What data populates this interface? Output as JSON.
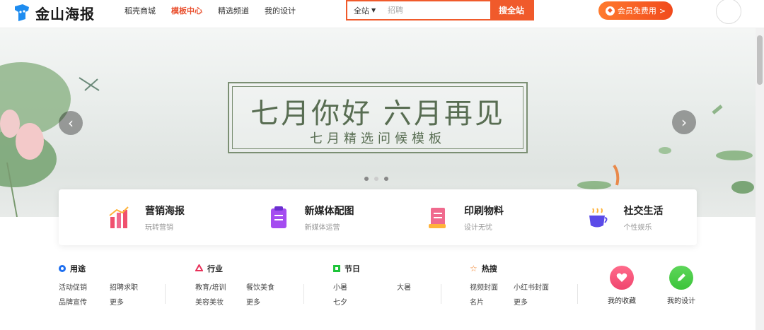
{
  "header": {
    "logo_text": "金山海报",
    "nav": [
      "稻壳商城",
      "模板中心",
      "精选频道",
      "我的设计"
    ],
    "active_nav": "模板中心",
    "search": {
      "scope": "全站",
      "placeholder": "招聘",
      "button": "搜全站"
    },
    "vip_button": "会员免费用",
    "vip_arrow": ">"
  },
  "banner": {
    "title": "七月你好 六月再见",
    "subtitle": "七月精选问候模板",
    "prev": "‹",
    "next": "›",
    "slides": 3,
    "active_slide": 2
  },
  "categories": [
    {
      "title": "营销海报",
      "sub": "玩转营销",
      "icon": "bar-chart-icon",
      "color": "#f0506e"
    },
    {
      "title": "新媒体配图",
      "sub": "新媒体运营",
      "icon": "clipboard-icon",
      "color": "#a44cf0"
    },
    {
      "title": "印刷物料",
      "sub": "设计无忧",
      "icon": "document-icon",
      "color": "#f06a8e"
    },
    {
      "title": "社交生活",
      "sub": "个性娱乐",
      "icon": "coffee-cup-icon",
      "color": "#5b4be8"
    }
  ],
  "tag_sections": [
    {
      "head": "用途",
      "icon": "circle-icon",
      "color": "#1e6ff0",
      "items": [
        "活动促销",
        "招聘求职",
        "品牌宣传",
        "更多"
      ]
    },
    {
      "head": "行业",
      "icon": "triangle-icon",
      "color": "#e8325a",
      "items": [
        "教育/培训",
        "餐饮美食",
        "美容美妆",
        "更多"
      ]
    },
    {
      "head": "节日",
      "icon": "square-icon",
      "color": "#1ec43a",
      "items": [
        "小暑",
        "大暑",
        "七夕"
      ]
    },
    {
      "head": "热搜",
      "icon": "star-icon",
      "color": "#f07a1e",
      "items": [
        "视频封面",
        "小红书封面",
        "名片",
        "更多"
      ]
    }
  ],
  "quick_actions": [
    {
      "label": "我的收藏",
      "icon": "heart-icon",
      "color": "#f0456e"
    },
    {
      "label": "我的设计",
      "icon": "pencil-icon",
      "color": "#3cc43a"
    }
  ]
}
